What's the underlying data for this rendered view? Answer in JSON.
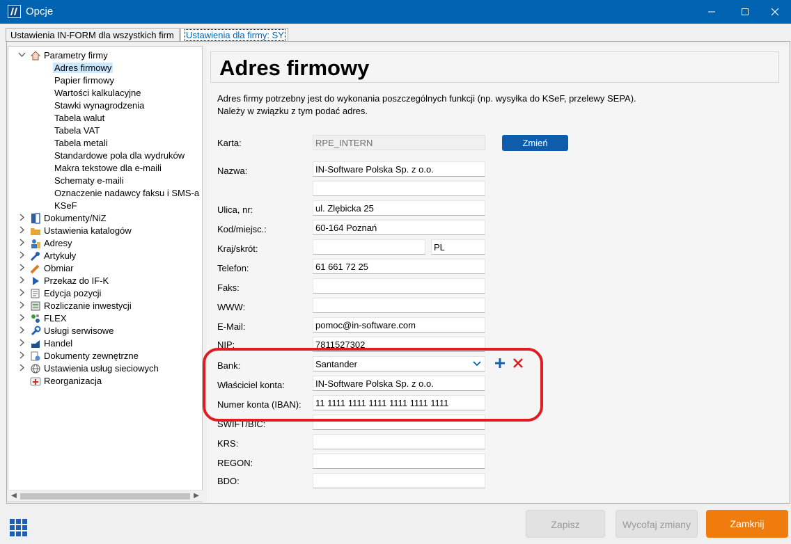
{
  "window": {
    "title": "Opcje",
    "minimize_icon": "minimize-icon",
    "maximize_icon": "maximize-icon",
    "close_icon": "close-icon"
  },
  "tabs": [
    {
      "label": "Ustawienia IN-FORM dla wszystkich firm",
      "active": false
    },
    {
      "label": "Ustawienia dla firmy: SY",
      "active": true
    }
  ],
  "tree": {
    "parent": {
      "label": "Parametry firmy",
      "icon": "home-icon",
      "expanded": true
    },
    "children": [
      {
        "label": "Adres firmowy",
        "selected": true
      },
      {
        "label": "Papier firmowy"
      },
      {
        "label": "Wartości kalkulacyjne"
      },
      {
        "label": "Stawki wynagrodzenia"
      },
      {
        "label": "Tabela walut"
      },
      {
        "label": "Tabela VAT"
      },
      {
        "label": "Tabela metali"
      },
      {
        "label": "Standardowe pola dla wydruków"
      },
      {
        "label": "Makra tekstowe dla e-maili"
      },
      {
        "label": "Schematy e-maili"
      },
      {
        "label": "Oznaczenie nadawcy faksu i SMS-a"
      },
      {
        "label": "KSeF"
      }
    ],
    "sections": [
      {
        "label": "Dokumenty/NiZ",
        "icon": "documents-icon"
      },
      {
        "label": "Ustawienia katalogów",
        "icon": "folder-icon"
      },
      {
        "label": "Adresy",
        "icon": "address-book-icon"
      },
      {
        "label": "Artykuły",
        "icon": "tools-icon"
      },
      {
        "label": "Obmiar",
        "icon": "pencil-icon"
      },
      {
        "label": "Przekaz do IF-K",
        "icon": "play-icon"
      },
      {
        "label": "Edycja pozycji",
        "icon": "edit-icon"
      },
      {
        "label": "Rozliczanie inwestycji",
        "icon": "ledger-icon"
      },
      {
        "label": "FLEX",
        "icon": "flex-icon"
      },
      {
        "label": "Usługi serwisowe",
        "icon": "wrench-icon"
      },
      {
        "label": "Handel",
        "icon": "trade-icon"
      },
      {
        "label": "Dokumenty zewnętrzne",
        "icon": "external-docs-icon"
      },
      {
        "label": "Ustawienia usług sieciowych",
        "icon": "globe-icon"
      },
      {
        "label": "Reorganizacja",
        "icon": "first-aid-icon"
      }
    ]
  },
  "content": {
    "title": "Adres firmowy",
    "description_line1": "Adres firmy potrzebny jest do wykonania poszczególnych funkcji (np. wysyłka do KSeF, przelewy SEPA).",
    "description_line2": "Należy w związku z tym podać adres."
  },
  "form": {
    "karta": {
      "label": "Karta:",
      "value": "RPE_INTERN",
      "button": "Zmień"
    },
    "nazwa": {
      "label": "Nazwa:",
      "value": "IN-Software Polska Sp. z o.o.",
      "value2": ""
    },
    "ulica": {
      "label": "Ulica, nr:",
      "value": "ul. Zlębicka 25"
    },
    "kod": {
      "label": "Kod/miejsc.:",
      "value": "60-164 Poznań"
    },
    "kraj": {
      "label": "Kraj/skrót:",
      "value": "",
      "short": "PL"
    },
    "telefon": {
      "label": "Telefon:",
      "value": "61 661 72 25"
    },
    "faks": {
      "label": "Faks:",
      "value": ""
    },
    "www": {
      "label": "WWW:",
      "value": ""
    },
    "email": {
      "label": "E-Mail:",
      "value": "pomoc@in-software.com"
    },
    "nip": {
      "label": "NIP:",
      "value": "7811527302"
    },
    "bank": {
      "label": "Bank:",
      "value": "Santander"
    },
    "wlasciciel": {
      "label": "Właściciel konta:",
      "value": "IN-Software Polska Sp. z o.o."
    },
    "iban": {
      "label": "Numer konta (IBAN):",
      "value": "11 1111 1111 1111 1111 1111 1111"
    },
    "swift": {
      "label": "SWIFT/BIC:",
      "value": ""
    },
    "krs": {
      "label": "KRS:",
      "value": ""
    },
    "regon": {
      "label": "REGON:",
      "value": ""
    },
    "bdo": {
      "label": "BDO:",
      "value": ""
    }
  },
  "footer": {
    "save": "Zapisz",
    "revert": "Wycofaj zmiany",
    "close": "Zamknij"
  },
  "colors": {
    "titlebar": "#0063b1",
    "highlight": "#e01b22",
    "primary_button": "#f07c0d",
    "accent_button": "#0f5cab"
  }
}
